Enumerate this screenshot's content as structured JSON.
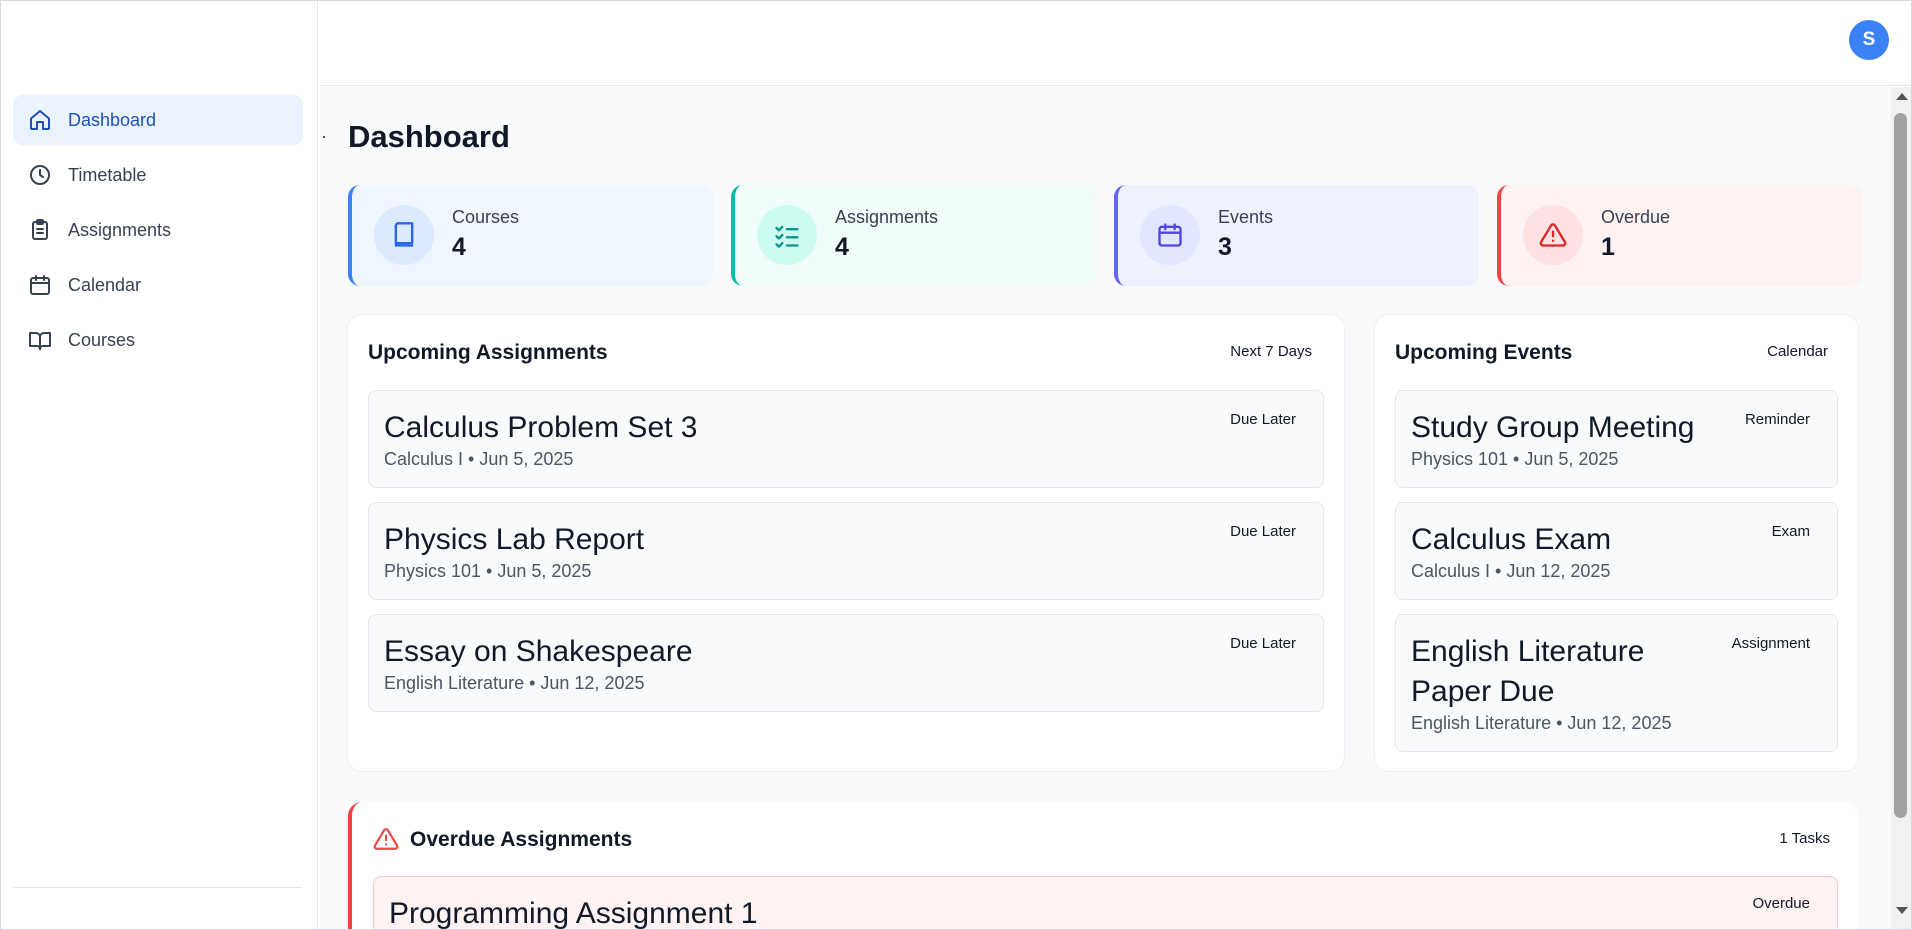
{
  "sidebar": {
    "items": [
      {
        "label": "Dashboard",
        "icon": "home-icon",
        "active": true
      },
      {
        "label": "Timetable",
        "icon": "clock-icon"
      },
      {
        "label": "Assignments",
        "icon": "clipboard-icon"
      },
      {
        "label": "Calendar",
        "icon": "calendar-icon"
      },
      {
        "label": "Courses",
        "icon": "book-open-icon"
      }
    ]
  },
  "header": {
    "theme_icon": "moon-icon",
    "avatar_initial": "S"
  },
  "main": {
    "title": "Dashboard",
    "stats": [
      {
        "label": "Courses",
        "value": "4",
        "icon": "book-icon",
        "accent": "#3b82f6",
        "bg": "#eff6ff"
      },
      {
        "label": "Assignments",
        "value": "4",
        "icon": "list-checks-icon",
        "accent": "#14b8a6",
        "bg": "#f0fdfa"
      },
      {
        "label": "Events",
        "value": "3",
        "icon": "calendar-icon",
        "accent": "#6366f1",
        "bg": "#eef2ff"
      },
      {
        "label": "Overdue",
        "value": "1",
        "icon": "alert-triangle-icon",
        "accent": "#ef4444",
        "bg": "#fef2f2"
      }
    ],
    "upcoming_assignments": {
      "title": "Upcoming Assignments",
      "badge": "Next 7 Days",
      "items": [
        {
          "title": "Calculus Problem Set 3",
          "meta": "Calculus I • Jun 5, 2025",
          "tag": "Due Later"
        },
        {
          "title": "Physics Lab Report",
          "meta": "Physics 101 • Jun 5, 2025",
          "tag": "Due Later"
        },
        {
          "title": "Essay on Shakespeare",
          "meta": "English Literature • Jun 12, 2025",
          "tag": "Due Later"
        }
      ]
    },
    "upcoming_events": {
      "title": "Upcoming Events",
      "badge": "Calendar",
      "items": [
        {
          "title": "Study Group Meeting",
          "meta": "Physics 101 • Jun 5, 2025",
          "tag": "Reminder"
        },
        {
          "title": "Calculus Exam",
          "meta": "Calculus I • Jun 12, 2025",
          "tag": "Exam"
        },
        {
          "title": "English Literature Paper Due",
          "meta": "English Literature • Jun 12, 2025",
          "tag": "Assignment"
        }
      ]
    },
    "overdue": {
      "title": "Overdue Assignments",
      "count": "1 Tasks",
      "items": [
        {
          "title": "Programming Assignment 1",
          "tag": "Overdue"
        }
      ]
    }
  },
  "colors": {
    "primary": "#3b82f6",
    "active_nav_bg": "#eaf2fd",
    "active_nav_text": "#1e4fb8",
    "danger": "#ef4444"
  }
}
